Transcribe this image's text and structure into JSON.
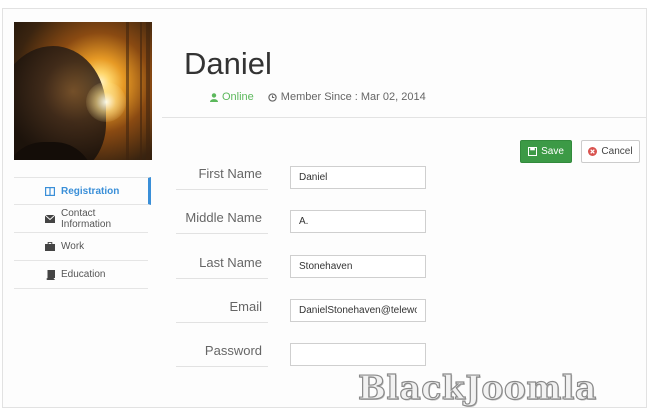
{
  "profile": {
    "name": "Daniel",
    "status": "Online",
    "member_since": "Member Since : Mar 02, 2014"
  },
  "actions": {
    "save_label": "Save",
    "cancel_label": "Cancel"
  },
  "sidebar": {
    "items": [
      {
        "label": "Registration",
        "icon": "columns-icon",
        "active": true
      },
      {
        "label": "Contact Information",
        "icon": "envelope-icon",
        "active": false
      },
      {
        "label": "Work",
        "icon": "briefcase-icon",
        "active": false
      },
      {
        "label": "Education",
        "icon": "book-icon",
        "active": false
      }
    ]
  },
  "form": {
    "first_name": {
      "label": "First Name",
      "value": "Daniel"
    },
    "middle_name": {
      "label": "Middle Name",
      "value": "A."
    },
    "last_name": {
      "label": "Last Name",
      "value": "Stonehaven"
    },
    "email": {
      "label": "Email",
      "value": "DanielStonehaven@telewo"
    },
    "password": {
      "label": "Password",
      "value": ""
    }
  },
  "watermark": "BlackJoomla",
  "colors": {
    "accent": "#3a8fd8",
    "online": "#5cb85c",
    "save": "#3c9a46",
    "cancel_icon": "#d9534f"
  }
}
